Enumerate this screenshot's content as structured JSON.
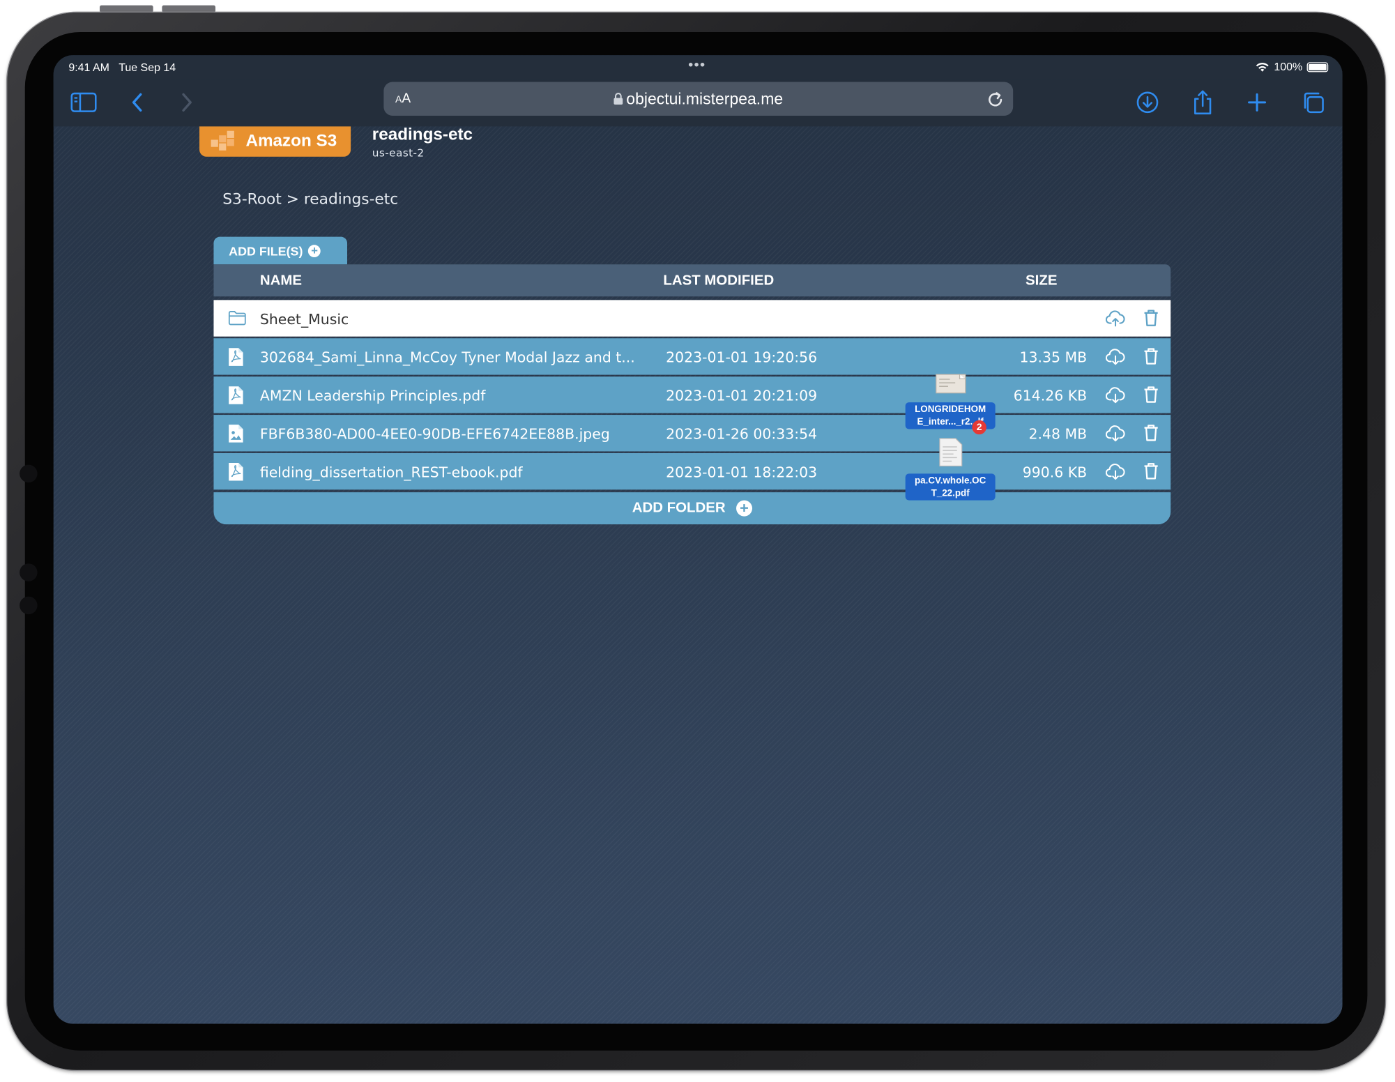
{
  "status_bar": {
    "time": "9:41 AM",
    "date": "Tue Sep 14",
    "battery": "100%"
  },
  "browser": {
    "text_size_label": "AA",
    "url": "objectui.misterpea.me"
  },
  "header": {
    "logo_text": "Amazon S3",
    "bucket_name": "readings-etc",
    "region": "us-east-2"
  },
  "breadcrumb": "S3-Root > readings-etc",
  "add_files_label": "ADD FILE(S)",
  "table": {
    "columns": {
      "name": "NAME",
      "modified": "LAST MODIFIED",
      "size": "SIZE"
    },
    "folders": [
      {
        "name": "Sheet_Music"
      }
    ],
    "files": [
      {
        "icon": "pdf-file-icon",
        "name": "302684_Sami_Linna_McCoy Tyner Modal Jazz and t...",
        "modified": "2023-01-01 19:20:56",
        "size": "13.35 MB"
      },
      {
        "icon": "pdf-file-icon",
        "name": "AMZN Leadership Principles.pdf",
        "modified": "2023-01-01 20:21:09",
        "size": "614.26 KB"
      },
      {
        "icon": "image-file-icon",
        "name": "FBF6B380-AD00-4EE0-90DB-EFE6742EE88B.jpeg",
        "modified": "2023-01-26 00:33:54",
        "size": "2.48 MB"
      },
      {
        "icon": "pdf-file-icon",
        "name": "fielding_dissertation_REST-ebook.pdf",
        "modified": "2023-01-01 18:22:03",
        "size": "990.6 KB"
      }
    ]
  },
  "add_folder_label": "ADD FOLDER",
  "drag_items": [
    {
      "label_line1": "LONGRIDEHOM",
      "label_line2": "E_inter..._r2...lf",
      "badge": "2"
    },
    {
      "label_line1": "pa.CV.whole.OC",
      "label_line2": "T_22.pdf"
    }
  ],
  "colors": {
    "row_blue": "#5ea2c6",
    "header_slate": "#4a6078",
    "s3_orange": "#e8912f",
    "badge_red": "#e53935",
    "drag_label_blue": "#1f64c8"
  }
}
